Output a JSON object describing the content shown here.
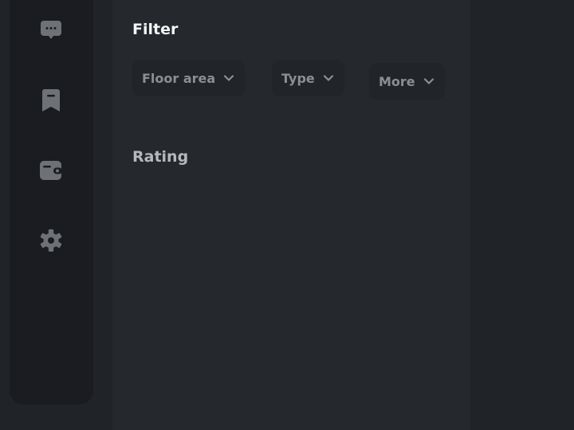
{
  "sidebar": {
    "items": [
      {
        "icon": "chat-bubble-icon",
        "label": "Messages"
      },
      {
        "icon": "bookmark-icon",
        "label": "Saved"
      },
      {
        "icon": "wallet-icon",
        "label": "Wallet"
      },
      {
        "icon": "gear-icon",
        "label": "Settings"
      }
    ]
  },
  "filter": {
    "title": "Filter",
    "chips": [
      {
        "label": "Floor area",
        "icon": "chevron-down-icon"
      },
      {
        "label": "Type",
        "icon": "chevron-down-icon"
      },
      {
        "label": "More",
        "icon": "chevron-down-icon"
      }
    ]
  },
  "rating": {
    "title": "Rating"
  },
  "colors": {
    "background": "#202328",
    "sidebar": "#1a1c21",
    "panel": "#25282d",
    "chip": "#212429",
    "icon": "#6e7176",
    "title": "#f4f5f6",
    "muted_text": "#8b8e93"
  }
}
